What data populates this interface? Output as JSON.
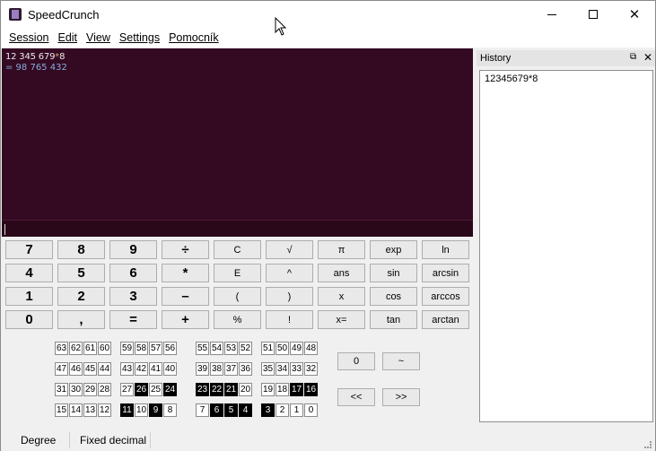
{
  "window": {
    "title": "SpeedCrunch"
  },
  "menu": [
    {
      "label": "Session",
      "id": "session"
    },
    {
      "label": "Edit",
      "id": "edit"
    },
    {
      "label": "View",
      "id": "view"
    },
    {
      "label": "Settings",
      "id": "settings"
    },
    {
      "label": "Pomocník",
      "id": "pomocnik"
    }
  ],
  "display": {
    "expression_digits": "12 345 679",
    "expression_operator": "*",
    "expression_tail": "8",
    "result": "= 98 765 432"
  },
  "history": {
    "title": "History",
    "items": [
      "12345679*8"
    ]
  },
  "keypad": {
    "rows": [
      [
        "7",
        "8",
        "9",
        "÷",
        "C",
        "√",
        "π",
        "exp",
        "ln"
      ],
      [
        "4",
        "5",
        "6",
        "*",
        "E",
        "^",
        "ans",
        "sin",
        "arcsin"
      ],
      [
        "1",
        "2",
        "3",
        "–",
        "(",
        ")",
        "x",
        "cos",
        "arccos"
      ],
      [
        "0",
        ",",
        "=",
        "+",
        "%",
        "!",
        "x=",
        "tan",
        "arctan"
      ]
    ]
  },
  "bitfield": {
    "rows": [
      [
        "63",
        "62",
        "61",
        "60",
        "59",
        "58",
        "57",
        "56",
        "55",
        "54",
        "53",
        "52",
        "51",
        "50",
        "49",
        "48"
      ],
      [
        "47",
        "46",
        "45",
        "44",
        "43",
        "42",
        "41",
        "40",
        "39",
        "38",
        "37",
        "36",
        "35",
        "34",
        "33",
        "32"
      ],
      [
        "31",
        "30",
        "29",
        "28",
        "27",
        "26",
        "25",
        "24",
        "23",
        "22",
        "21",
        "20",
        "19",
        "18",
        "17",
        "16"
      ],
      [
        "15",
        "14",
        "13",
        "12",
        "11",
        "10",
        "9",
        "8",
        "7",
        "6",
        "5",
        "4",
        "3",
        "2",
        "1",
        "0"
      ]
    ],
    "set_bits": [
      "26",
      "24",
      "23",
      "22",
      "21",
      "17",
      "16",
      "11",
      "9",
      "6",
      "5",
      "4",
      "3"
    ],
    "buttons": {
      "clear": "0",
      "invert": "~",
      "shift_left": "<<",
      "shift_right": ">>"
    }
  },
  "status": {
    "angle_mode": "Degree",
    "result_format": "Fixed decimal"
  }
}
